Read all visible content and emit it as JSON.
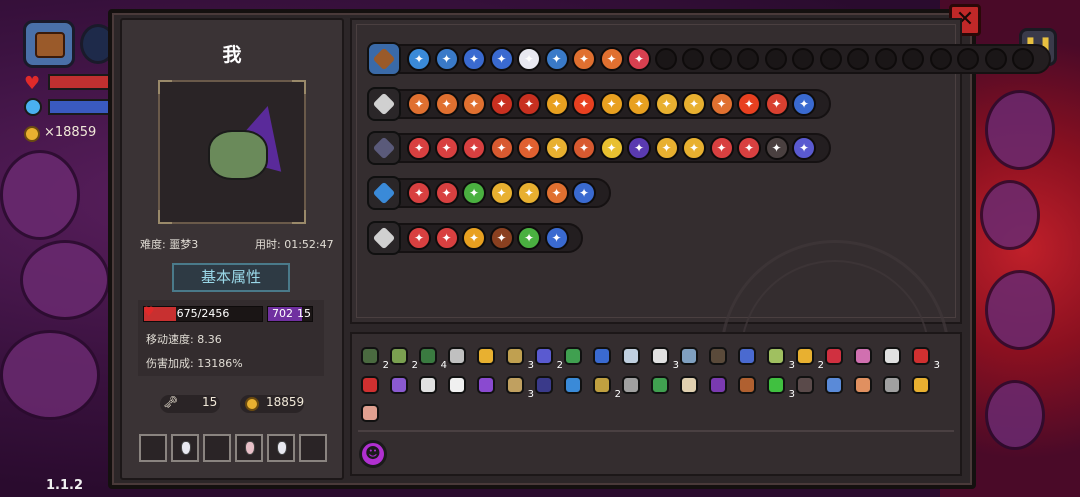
{
  "hud": {
    "gold": "×18859"
  },
  "version": "1.1.2",
  "player": {
    "name": "我",
    "difficulty": "难度: 噩梦3",
    "time": "用时: 01:52:47",
    "attr_button": "基本属性",
    "hp": "675/2456",
    "hp_fraction": 0.275,
    "mana": "702",
    "mana_extra": "15",
    "move_speed": "移动速度: 8.36",
    "damage_bonus": "伤害加成: 13186%",
    "keys": "15",
    "gold": "18859"
  },
  "weapons": [
    {
      "name": "bag",
      "icon_color": "#9a5a2a",
      "frame_color": "#3a6aa8",
      "skills": [
        "#3a8ad8",
        "#3a7ac8",
        "#3a6ad0",
        "#3a6ad0",
        "#e8e8f0",
        "#3a7ac8",
        "#e07030",
        "#e07030",
        "#d84050"
      ],
      "empty_slots": 14
    },
    {
      "name": "morningstar",
      "icon_color": "#d0d0d0",
      "frame_color": "#2a2628",
      "skills": [
        "#e07030",
        "#e07030",
        "#e07030",
        "#c83020",
        "#c83020",
        "#e8a020",
        "#e84020",
        "#e8a020",
        "#e8a020",
        "#e8b030",
        "#e8b030",
        "#e07030",
        "#e84020",
        "#d84030",
        "#3a6ad0"
      ]
    },
    {
      "name": "spellbook",
      "icon_color": "#5a5a7a",
      "frame_color": "#2a2628",
      "skills": [
        "#d84040",
        "#d84040",
        "#d84040",
        "#d85a30",
        "#e06030",
        "#e8b030",
        "#d85a30",
        "#e8c030",
        "#5a3ab0",
        "#e8b030",
        "#e8b030",
        "#d84040",
        "#d84040",
        "#4a4040",
        "#5a5ad0"
      ]
    },
    {
      "name": "staff",
      "icon_color": "#3a8ad8",
      "frame_color": "#2a2628",
      "skills": [
        "#d84040",
        "#d84040",
        "#4ab040",
        "#e8b030",
        "#e8b030",
        "#e07030",
        "#3a6ad0"
      ]
    },
    {
      "name": "sword",
      "icon_color": "#d0d0d0",
      "frame_color": "#2a2628",
      "skills": [
        "#d84040",
        "#d84040",
        "#e8a020",
        "#8a4020",
        "#4ab040",
        "#3a6ad0"
      ]
    }
  ],
  "items_row1": [
    {
      "icon": "skull-icon",
      "color": "#4a6a40",
      "count": "2"
    },
    {
      "icon": "fly-icon",
      "color": "#7aa050",
      "count": "2"
    },
    {
      "icon": "cloth-icon",
      "color": "#3a7a40",
      "count": "4"
    },
    {
      "icon": "glasses-icon",
      "color": "#c0c0c0",
      "count": ""
    },
    {
      "icon": "bird-icon",
      "color": "#e8b030",
      "count": ""
    },
    {
      "icon": "lantern-icon",
      "color": "#c0a050",
      "count": "3"
    },
    {
      "icon": "planet-icon",
      "color": "#5a5ad0",
      "count": "2"
    },
    {
      "icon": "hat-icon",
      "color": "#40a050",
      "count": ""
    },
    {
      "icon": "teapot-icon",
      "color": "#3a6ad0",
      "count": ""
    },
    {
      "icon": "key-icon",
      "color": "#c0d0e0",
      "count": ""
    },
    {
      "icon": "teeth-icon",
      "color": "#e0e0e0",
      "count": "3"
    },
    {
      "icon": "globe-icon",
      "color": "#80a0c0",
      "count": ""
    },
    {
      "icon": "beast-icon",
      "color": "#5a4a3a",
      "count": ""
    },
    {
      "icon": "potion-icon",
      "color": "#4a6ad0",
      "count": ""
    },
    {
      "icon": "scroll-icon",
      "color": "#a0c060",
      "count": "3"
    },
    {
      "icon": "cheese-icon",
      "color": "#e8b030",
      "count": "2"
    },
    {
      "icon": "worm-icon",
      "color": "#d03040",
      "count": ""
    },
    {
      "icon": "brain-icon",
      "color": "#d070b0",
      "count": ""
    },
    {
      "icon": "swirl-icon",
      "color": "#e0e0e0",
      "count": ""
    },
    {
      "icon": "clock-icon",
      "color": "#d03030",
      "count": "3"
    }
  ],
  "items_row2": [
    {
      "icon": "devil-icon",
      "color": "#d03030",
      "count": ""
    },
    {
      "icon": "gem-icon",
      "color": "#8a5ad0",
      "count": ""
    },
    {
      "icon": "dagger-icon",
      "color": "#e0e0e0",
      "count": ""
    },
    {
      "icon": "feather-icon",
      "color": "#f0f0f0",
      "count": ""
    },
    {
      "icon": "boot-icon",
      "color": "#8a4ad0",
      "count": ""
    },
    {
      "icon": "pickaxe-icon",
      "color": "#c0a060",
      "count": "3"
    },
    {
      "icon": "wizard-hat-icon",
      "color": "#3a3a8a",
      "count": ""
    },
    {
      "icon": "magnifier-icon",
      "color": "#3a8ad8",
      "count": ""
    },
    {
      "icon": "horn-icon",
      "color": "#c0a040",
      "count": "2"
    },
    {
      "icon": "cage-icon",
      "color": "#a0a0a0",
      "count": ""
    },
    {
      "icon": "ghost-icon",
      "color": "#40a050",
      "count": ""
    },
    {
      "icon": "bone-icon",
      "color": "#e0d0b0",
      "count": ""
    },
    {
      "icon": "hat2-icon",
      "color": "#7a3ab0",
      "count": ""
    },
    {
      "icon": "barrel-icon",
      "color": "#b06030",
      "count": ""
    },
    {
      "icon": "clover-icon",
      "color": "#40c040",
      "count": "3"
    },
    {
      "icon": "cape-icon",
      "color": "#5a4a4a",
      "count": ""
    },
    {
      "icon": "crystal-icon",
      "color": "#5a8ad8",
      "count": ""
    },
    {
      "icon": "ring-icon",
      "color": "#e09060",
      "count": ""
    },
    {
      "icon": "bottle-icon",
      "color": "#a0a0a0",
      "count": ""
    },
    {
      "icon": "card-icon",
      "color": "#e8b030",
      "count": ""
    }
  ],
  "items_row3": [
    {
      "icon": "meat-icon",
      "color": "#e0a090",
      "count": ""
    }
  ],
  "slots": [
    "empty",
    "potion-white",
    "empty",
    "potion-red",
    "potion-white",
    "empty"
  ]
}
